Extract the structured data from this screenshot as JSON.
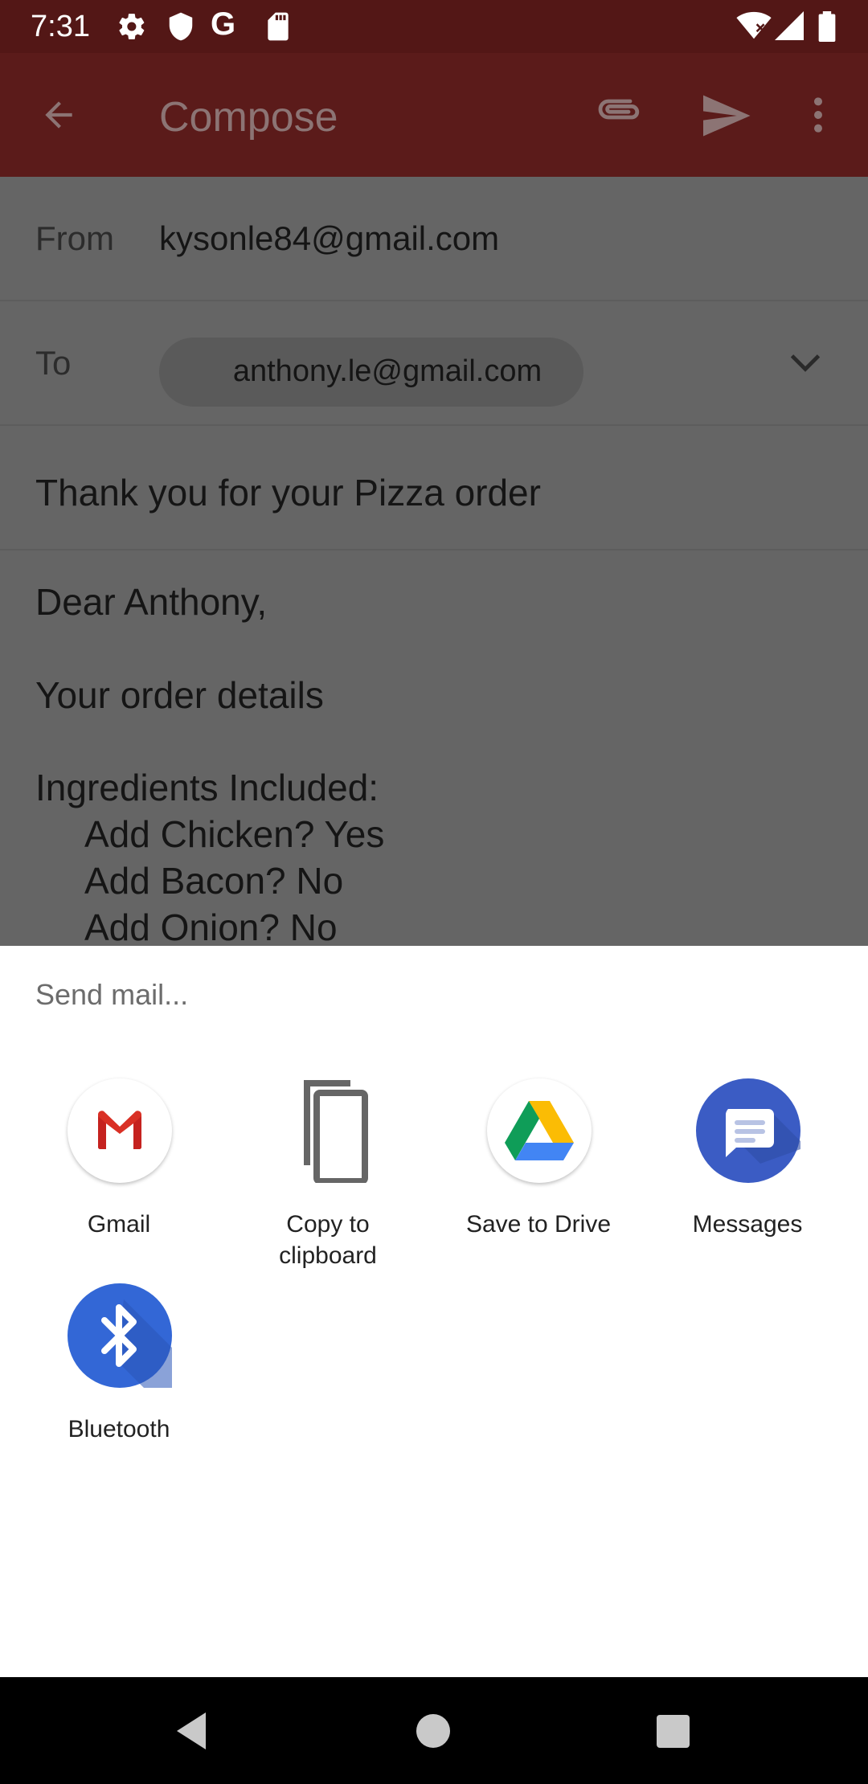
{
  "status_bar": {
    "time": "7:31",
    "icons": [
      "settings-icon",
      "shield-icon",
      "google-icon",
      "sd-card-icon",
      "wifi-icon",
      "signal-icon",
      "battery-icon"
    ],
    "google_glyph": "G"
  },
  "compose": {
    "title": "Compose",
    "from_label": "From",
    "from_value": "kysonle84@gmail.com",
    "to_label": "To",
    "to_chip": "anthony.le@gmail.com",
    "subject": "Thank you for your Pizza order",
    "body": {
      "greeting": "Dear Anthony,",
      "details": "Your order details",
      "ingredients_header": "Ingredients Included:",
      "lines": [
        "Add Chicken? Yes",
        "Add Bacon? No",
        "Add Onion? No"
      ]
    },
    "icons": [
      "back-arrow-icon",
      "attach-icon",
      "send-icon",
      "more-vert-icon",
      "chevron-down-icon"
    ]
  },
  "share_sheet": {
    "title": "Send mail...",
    "targets": [
      {
        "label": "Gmail",
        "icon": "gmail-icon"
      },
      {
        "label": "Copy to\nclipboard",
        "icon": "copy-icon"
      },
      {
        "label": "Save to Drive",
        "icon": "drive-icon"
      },
      {
        "label": "Messages",
        "icon": "messages-icon"
      },
      {
        "label": "Bluetooth",
        "icon": "bluetooth-icon"
      }
    ]
  },
  "nav_bar": {
    "icons": [
      "nav-back-icon",
      "nav-home-icon",
      "nav-recents-icon"
    ]
  },
  "colors": {
    "status_bar": "#531716",
    "app_bar_dimmed": "#5b1b1a",
    "scrim_background": "#656565",
    "sheet_background": "#ffffff",
    "bluetooth_blue": "#3367d6",
    "messages_blue": "#3b5cc4"
  }
}
